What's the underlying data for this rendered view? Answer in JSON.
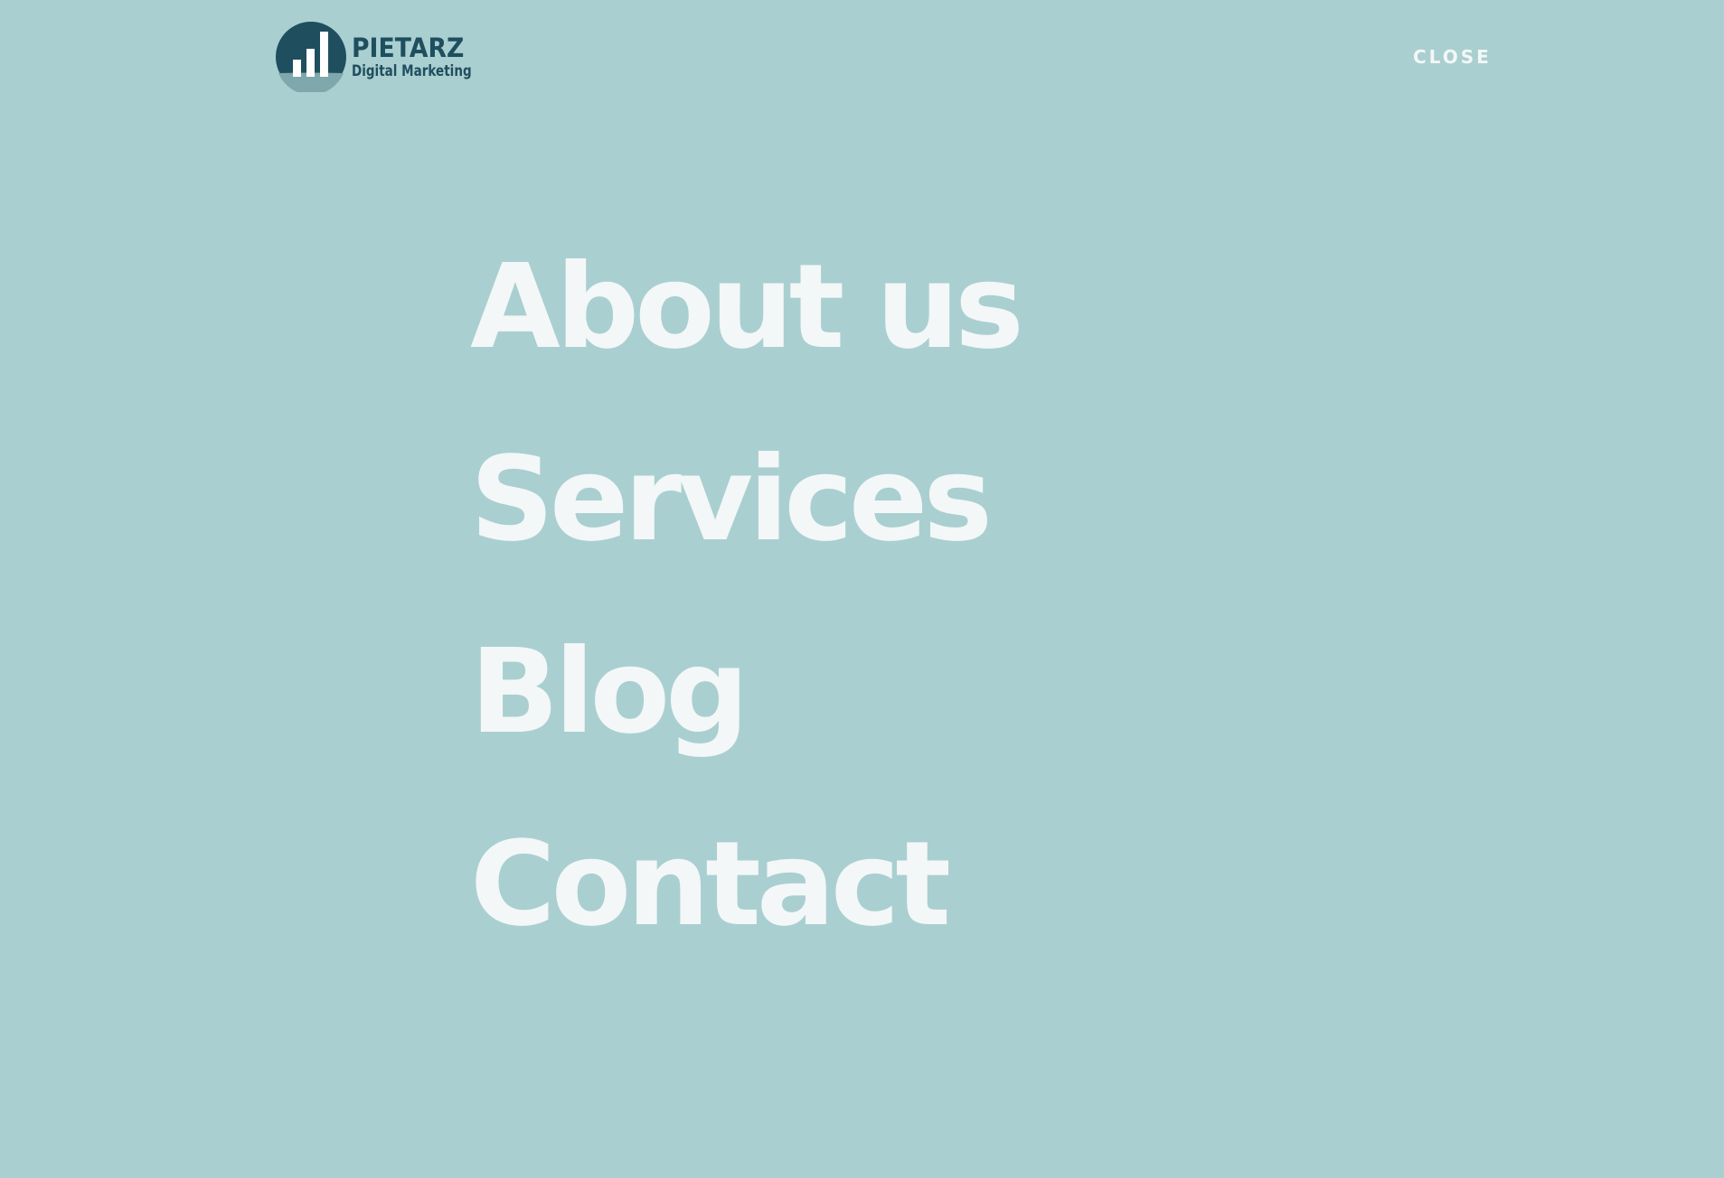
{
  "theme": {
    "background": "#aacfd0",
    "menu_text": "#f3f7f7",
    "brand_dark": "#1f4e5f",
    "brand_light": "#7fa8ad"
  },
  "logo": {
    "name": "PIETARZ",
    "tagline": "Digital Marketing",
    "icon": "bar-chart-logo-icon"
  },
  "close": {
    "label": "CLOSE"
  },
  "menu": {
    "items": [
      {
        "label": "About us"
      },
      {
        "label": "Services"
      },
      {
        "label": "Blog"
      },
      {
        "label": "Contact"
      }
    ]
  }
}
